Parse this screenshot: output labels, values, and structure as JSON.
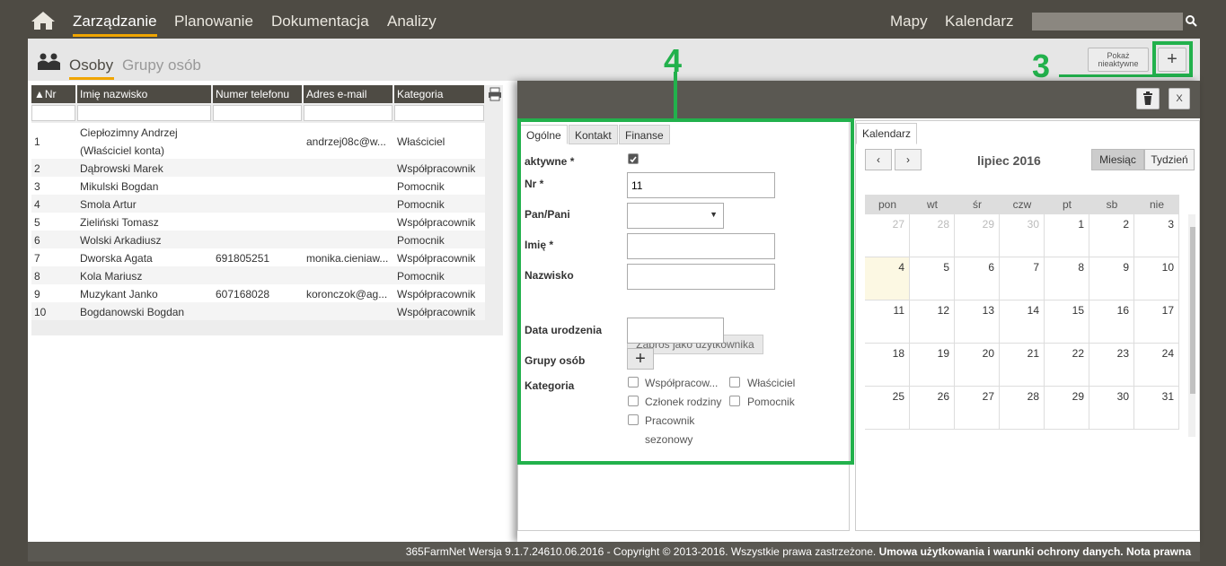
{
  "nav": {
    "items": [
      "Zarządzanie",
      "Planowanie",
      "Dokumentacja",
      "Analizy"
    ],
    "right_items": [
      "Mapy",
      "Kalendarz"
    ],
    "search_value": ""
  },
  "subheader": {
    "tabs": [
      "Osoby",
      "Grupy osób"
    ],
    "inactive_button_line1": "Pokaż",
    "inactive_button_line2": "nieaktywne",
    "add_button": "+"
  },
  "annotations": {
    "label3": "3",
    "label4": "4"
  },
  "people_table": {
    "columns": [
      "Nr",
      "Imię nazwisko",
      "Numer telefonu",
      "Adres e-mail",
      "Kategoria"
    ],
    "rows": [
      {
        "nr": "1",
        "name": "Ciepłozimny Andrzej",
        "name2": "(Właściciel konta)",
        "phone": "",
        "email": "andrzej08c@w...",
        "category": "Właściciel"
      },
      {
        "nr": "2",
        "name": "Dąbrowski Marek",
        "phone": "",
        "email": "",
        "category": "Współpracownik"
      },
      {
        "nr": "3",
        "name": "Mikulski Bogdan",
        "phone": "",
        "email": "",
        "category": "Pomocnik"
      },
      {
        "nr": "4",
        "name": "Smola Artur",
        "phone": "",
        "email": "",
        "category": "Pomocnik"
      },
      {
        "nr": "5",
        "name": "Zieliński Tomasz",
        "phone": "",
        "email": "",
        "category": "Współpracownik"
      },
      {
        "nr": "6",
        "name": "Wolski Arkadiusz",
        "phone": "",
        "email": "",
        "category": "Pomocnik"
      },
      {
        "nr": "7",
        "name": "Dworska Agata",
        "phone": "691805251",
        "email": "monika.cieniaw...",
        "category": "Współpracownik"
      },
      {
        "nr": "8",
        "name": "Kola Mariusz",
        "phone": "",
        "email": "",
        "category": "Pomocnik"
      },
      {
        "nr": "9",
        "name": "Muzykant Janko",
        "phone": "607168028",
        "email": "koronczok@ag...",
        "category": "Współpracownik"
      },
      {
        "nr": "10",
        "name": "Bogdanowski Bogdan",
        "phone": "",
        "email": "",
        "category": "Współpracownik"
      }
    ]
  },
  "detail": {
    "close_label": "X",
    "tabs": [
      "Ogólne",
      "Kontakt",
      "Finanse"
    ],
    "form": {
      "active_label": "aktywne *",
      "active_checked": true,
      "nr_label": "Nr *",
      "nr_value": "11",
      "salutation_label": "Pan/Pani",
      "salutation_value": "",
      "firstname_label": "Imię *",
      "firstname_value": "",
      "lastname_label": "Nazwisko",
      "lastname_value": "",
      "invite_button": "Zaproś jako użytkownika",
      "birthdate_label": "Data urodzenia",
      "birthdate_value": "",
      "groups_label": "Grupy osób",
      "groups_add": "+",
      "category_label": "Kategoria",
      "categories": [
        "Współpracow...",
        "Właściciel",
        "Członek rodziny",
        "Pomocnik",
        "Pracownik",
        "sezonowy"
      ]
    }
  },
  "calendar": {
    "tab": "Kalendarz",
    "title": "lipiec 2016",
    "prev": "‹",
    "next": "›",
    "view_month": "Miesiąc",
    "view_week": "Tydzień",
    "weekdays": [
      "pon",
      "wt",
      "śr",
      "czw",
      "pt",
      "sb",
      "nie"
    ],
    "weeks": [
      [
        "27",
        "28",
        "29",
        "30",
        "1",
        "2",
        "3"
      ],
      [
        "4",
        "5",
        "6",
        "7",
        "8",
        "9",
        "10"
      ],
      [
        "11",
        "12",
        "13",
        "14",
        "15",
        "16",
        "17"
      ],
      [
        "18",
        "19",
        "20",
        "21",
        "22",
        "23",
        "24"
      ],
      [
        "25",
        "26",
        "27",
        "28",
        "29",
        "30",
        "31"
      ]
    ],
    "today": "4"
  },
  "footer": {
    "text": "365FarmNet Wersja 9.1.7.24610.06.2016 - Copyright © 2013-2016. Wszystkie prawa zastrzeżone. ",
    "terms": "Umowa użytkowania i warunki ochrony danych.",
    "legal": "Nota prawna"
  }
}
